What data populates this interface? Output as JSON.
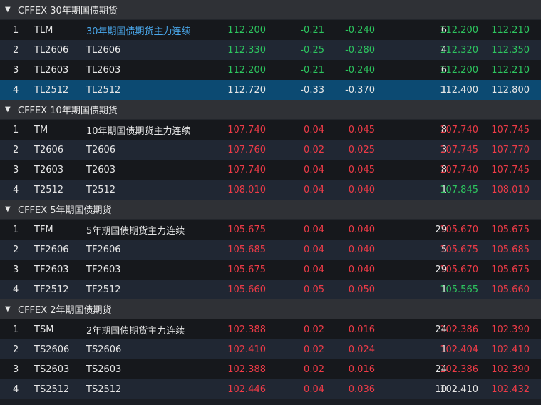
{
  "colors": {
    "up": "#ee3b47",
    "down": "#2dc55f",
    "flat": "#e6e6e6",
    "link": "#4aa8ec",
    "selected": "#0c4a72"
  },
  "groups": [
    {
      "title": "CFFEX 30年期国债期货",
      "rows": [
        {
          "idx": "1",
          "code": "TLM",
          "name": "30年期国债期货主力连续",
          "last": "112.200",
          "chg": "-0.21",
          "chgpct": "-0.240",
          "vol": "6",
          "bid": "112.200",
          "ask": "112.210",
          "name_c": "link",
          "last_c": "down",
          "chg_c": "down",
          "bid_c": "down",
          "ask_c": "down"
        },
        {
          "idx": "2",
          "code": "TL2606",
          "name": "TL2606",
          "last": "112.330",
          "chg": "-0.25",
          "chgpct": "-0.280",
          "vol": "4",
          "bid": "112.320",
          "ask": "112.350",
          "name_c": "flat",
          "last_c": "down",
          "chg_c": "down",
          "bid_c": "down",
          "ask_c": "down"
        },
        {
          "idx": "3",
          "code": "TL2603",
          "name": "TL2603",
          "last": "112.200",
          "chg": "-0.21",
          "chgpct": "-0.240",
          "vol": "6",
          "bid": "112.200",
          "ask": "112.210",
          "name_c": "flat",
          "last_c": "down",
          "chg_c": "down",
          "bid_c": "down",
          "ask_c": "down"
        },
        {
          "idx": "4",
          "code": "TL2512",
          "name": "TL2512",
          "last": "112.720",
          "chg": "-0.33",
          "chgpct": "-0.370",
          "vol": "1",
          "bid": "112.400",
          "ask": "112.800",
          "name_c": "flat",
          "last_c": "flat",
          "chg_c": "flat",
          "bid_c": "flat",
          "ask_c": "flat",
          "selected": true
        }
      ]
    },
    {
      "title": "CFFEX 10年期国债期货",
      "rows": [
        {
          "idx": "1",
          "code": "TM",
          "name": "10年期国债期货主力连续",
          "last": "107.740",
          "chg": "0.04",
          "chgpct": "0.045",
          "vol": "8",
          "bid": "107.740",
          "ask": "107.745",
          "name_c": "flat",
          "last_c": "up",
          "chg_c": "up",
          "bid_c": "up",
          "ask_c": "up"
        },
        {
          "idx": "2",
          "code": "T2606",
          "name": "T2606",
          "last": "107.760",
          "chg": "0.02",
          "chgpct": "0.025",
          "vol": "3",
          "bid": "107.745",
          "ask": "107.770",
          "name_c": "flat",
          "last_c": "up",
          "chg_c": "up",
          "bid_c": "up",
          "ask_c": "up"
        },
        {
          "idx": "3",
          "code": "T2603",
          "name": "T2603",
          "last": "107.740",
          "chg": "0.04",
          "chgpct": "0.045",
          "vol": "8",
          "bid": "107.740",
          "ask": "107.745",
          "name_c": "flat",
          "last_c": "up",
          "chg_c": "up",
          "bid_c": "up",
          "ask_c": "up"
        },
        {
          "idx": "4",
          "code": "T2512",
          "name": "T2512",
          "last": "108.010",
          "chg": "0.04",
          "chgpct": "0.040",
          "vol": "1",
          "bid": "107.845",
          "ask": "108.010",
          "name_c": "flat",
          "last_c": "up",
          "chg_c": "up",
          "bid_c": "down",
          "ask_c": "up"
        }
      ]
    },
    {
      "title": "CFFEX 5年期国债期货",
      "rows": [
        {
          "idx": "1",
          "code": "TFM",
          "name": "5年期国债期货主力连续",
          "last": "105.675",
          "chg": "0.04",
          "chgpct": "0.040",
          "vol": "29",
          "bid": "105.670",
          "ask": "105.675",
          "name_c": "flat",
          "last_c": "up",
          "chg_c": "up",
          "bid_c": "up",
          "ask_c": "up"
        },
        {
          "idx": "2",
          "code": "TF2606",
          "name": "TF2606",
          "last": "105.685",
          "chg": "0.04",
          "chgpct": "0.040",
          "vol": "5",
          "bid": "105.675",
          "ask": "105.685",
          "name_c": "flat",
          "last_c": "up",
          "chg_c": "up",
          "bid_c": "up",
          "ask_c": "up"
        },
        {
          "idx": "3",
          "code": "TF2603",
          "name": "TF2603",
          "last": "105.675",
          "chg": "0.04",
          "chgpct": "0.040",
          "vol": "29",
          "bid": "105.670",
          "ask": "105.675",
          "name_c": "flat",
          "last_c": "up",
          "chg_c": "up",
          "bid_c": "up",
          "ask_c": "up"
        },
        {
          "idx": "4",
          "code": "TF2512",
          "name": "TF2512",
          "last": "105.660",
          "chg": "0.05",
          "chgpct": "0.050",
          "vol": "1",
          "bid": "105.565",
          "ask": "105.660",
          "name_c": "flat",
          "last_c": "up",
          "chg_c": "up",
          "bid_c": "down",
          "ask_c": "up"
        }
      ]
    },
    {
      "title": "CFFEX 2年期国债期货",
      "rows": [
        {
          "idx": "1",
          "code": "TSM",
          "name": "2年期国债期货主力连续",
          "last": "102.388",
          "chg": "0.02",
          "chgpct": "0.016",
          "vol": "24",
          "bid": "102.386",
          "ask": "102.390",
          "name_c": "flat",
          "last_c": "up",
          "chg_c": "up",
          "bid_c": "up",
          "ask_c": "up"
        },
        {
          "idx": "2",
          "code": "TS2606",
          "name": "TS2606",
          "last": "102.410",
          "chg": "0.02",
          "chgpct": "0.024",
          "vol": "1",
          "bid": "102.404",
          "ask": "102.410",
          "name_c": "flat",
          "last_c": "up",
          "chg_c": "up",
          "bid_c": "up",
          "ask_c": "up"
        },
        {
          "idx": "3",
          "code": "TS2603",
          "name": "TS2603",
          "last": "102.388",
          "chg": "0.02",
          "chgpct": "0.016",
          "vol": "24",
          "bid": "102.386",
          "ask": "102.390",
          "name_c": "flat",
          "last_c": "up",
          "chg_c": "up",
          "bid_c": "up",
          "ask_c": "up"
        },
        {
          "idx": "4",
          "code": "TS2512",
          "name": "TS2512",
          "last": "102.446",
          "chg": "0.04",
          "chgpct": "0.036",
          "vol": "10",
          "bid": "102.410",
          "ask": "102.432",
          "name_c": "flat",
          "last_c": "up",
          "chg_c": "up",
          "bid_c": "flat",
          "ask_c": "up"
        }
      ]
    }
  ]
}
